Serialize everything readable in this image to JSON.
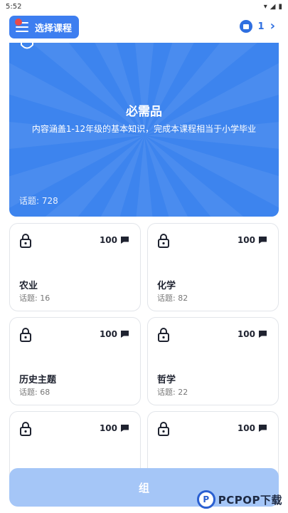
{
  "status_bar": {
    "time": "5:52",
    "icons": [
      "wifi-icon",
      "signal-icon",
      "battery-icon"
    ]
  },
  "header": {
    "course_select_label": "选择课程",
    "count": "1"
  },
  "hero": {
    "title": "必需品",
    "description": "内容涵盖1-12年级的基本知识，完成本课程相当于小学毕业",
    "topics": "话题: 728"
  },
  "cards": [
    {
      "name": "农业",
      "topics": "话题: 16",
      "points": "100"
    },
    {
      "name": "化学",
      "topics": "话题: 82",
      "points": "100"
    },
    {
      "name": "历史主题",
      "topics": "话题: 68",
      "points": "100"
    },
    {
      "name": "哲学",
      "topics": "话题: 22",
      "points": "100"
    },
    {
      "name": "",
      "topics": "",
      "points": "100"
    },
    {
      "name": "",
      "topics": "",
      "points": "100"
    }
  ],
  "bottom_button": {
    "label": "组"
  },
  "watermark": {
    "text": "PCPOP下载"
  },
  "colors": {
    "primary": "#3d7ef0",
    "button_disabled": "#a5c6f7",
    "accent_red": "#e84a4a"
  }
}
